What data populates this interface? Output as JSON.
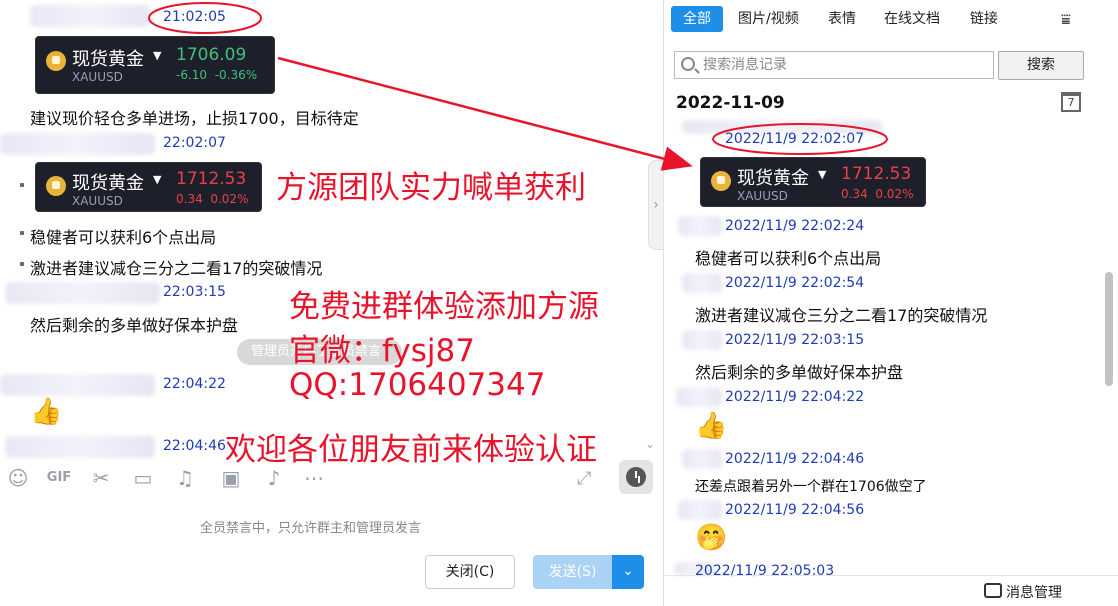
{
  "left_chat": {
    "messages": [
      {
        "time": "21:02:05"
      },
      {
        "text": "建议现价轻仓多单进场，止损1700，目标待定"
      },
      {
        "time": "22:02:07"
      },
      {
        "text": "稳健者可以获利6个点出局"
      },
      {
        "text": "激进者建议减仓三分之二看17的突破情况"
      },
      {
        "time": "22:03:15"
      },
      {
        "text": "然后剩余的多单做好保本护盘"
      },
      {
        "time": "22:04:22"
      },
      {
        "time": "22:04:46"
      }
    ],
    "quote_cards": [
      {
        "name": "现货黄金",
        "symbol": "XAUUSD",
        "price": "1706.09",
        "change": "-6.10",
        "change_pct": "-0.36%"
      },
      {
        "name": "现货黄金",
        "symbol": "XAUUSD",
        "price": "1712.53",
        "change": "0.34",
        "change_pct": "0.02%"
      }
    ],
    "notice_pill": "管理员开启了全员禁言",
    "disabled_note": "全员禁言中，只允许群主和管理员发言",
    "close_label": "关闭(C)",
    "send_label": "发送(S)"
  },
  "overlay_text": {
    "line1": "方源团队实力喊单获利",
    "line2": "免费进群体验添加方源",
    "line3": "官微：fysj87",
    "line4": "QQ:1706407347",
    "line5": "欢迎各位朋友前来体验认证"
  },
  "right_panel": {
    "tabs": [
      "全部",
      "图片/视频",
      "表情",
      "在线文档",
      "链接"
    ],
    "search_placeholder": "搜索消息记录",
    "search_button": "搜索",
    "date_header": "2022-11-09",
    "calendar_glyph": "7",
    "entries": [
      {
        "time": "2022/11/9 22:02:07"
      },
      {
        "time": "2022/11/9 22:02:24",
        "text": "稳健者可以获利6个点出局"
      },
      {
        "time": "2022/11/9 22:02:54",
        "text": "激进者建议减仓三分之二看17的突破情况"
      },
      {
        "time": "2022/11/9 22:03:15",
        "text": "然后剩余的多单做好保本护盘"
      },
      {
        "time": "2022/11/9 22:04:22"
      },
      {
        "time": "2022/11/9 22:04:46",
        "text": "还差点跟着另外一个群在1706做空了"
      },
      {
        "time": "2022/11/9 22:04:56"
      },
      {
        "time": "2022/11/9 22:05:03"
      }
    ],
    "quote_card": {
      "name": "现货黄金",
      "symbol": "XAUUSD",
      "price": "1712.53",
      "change": "0.34",
      "change_pct": "0.02%"
    },
    "footer_label": "消息管理"
  },
  "colors": {
    "accent_blue": "#1e8fe8",
    "timestamp_blue": "#1f3bb3",
    "overlay_red": "#e8142c",
    "quote_card_bg": "#1d1f2b",
    "up_green": "#3ec27a",
    "down_red": "#e8414a"
  }
}
